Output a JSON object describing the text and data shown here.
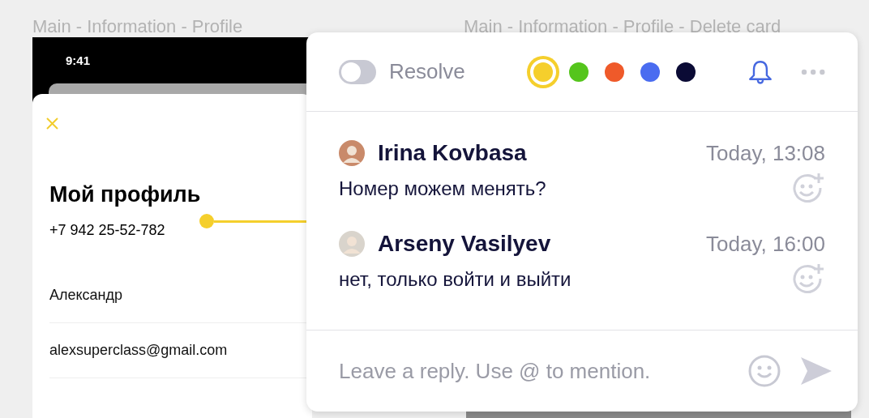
{
  "frames": [
    {
      "title": "Main - Information - Profile"
    },
    {
      "title": "Main - Information - Profile - Delete card"
    }
  ],
  "phone": {
    "status_time": "9:41",
    "heading": "Мой профиль",
    "phone_number": "+7 942 25-52-782",
    "fields": [
      "Александр",
      "alexsuperclass@gmail.com"
    ]
  },
  "comment_popup": {
    "resolve": {
      "label": "Resolve",
      "on": false
    },
    "colors": [
      {
        "color": "#f5cf2c",
        "selected": true
      },
      {
        "color": "#55c51c",
        "selected": false
      },
      {
        "color": "#ef5a2a",
        "selected": false
      },
      {
        "color": "#4a6cf0",
        "selected": false
      },
      {
        "color": "#0b0b35",
        "selected": false
      }
    ],
    "comments": [
      {
        "author": "Irina Kovbasa",
        "time": "Today, 13:08",
        "text": "Номер можем менять?"
      },
      {
        "author": "Arseny Vasilyev",
        "time": "Today, 16:00",
        "text": "нет, только войти и выйти"
      }
    ],
    "reply": {
      "placeholder": "Leave a reply. Use @ to mention."
    }
  }
}
